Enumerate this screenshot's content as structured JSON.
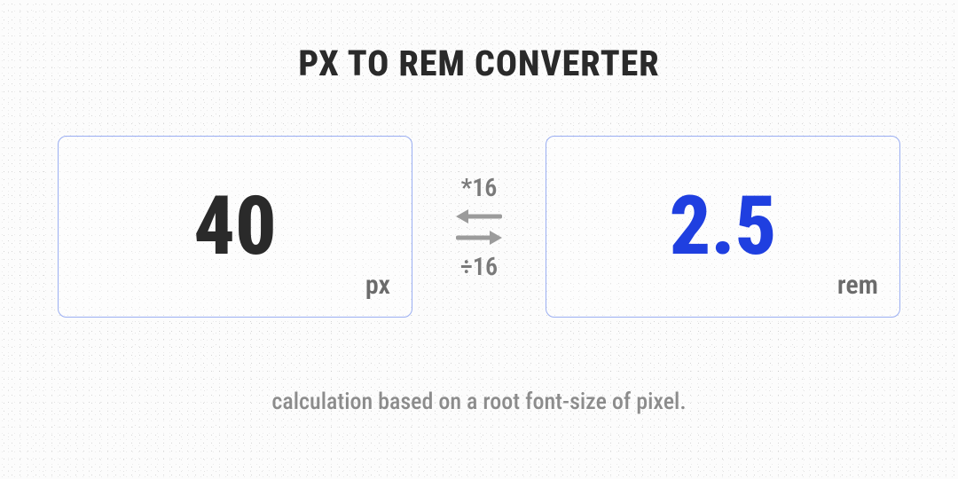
{
  "title": "PX TO REM CONVERTER",
  "left": {
    "value": "40",
    "unit": "px"
  },
  "right": {
    "value": "2.5",
    "unit": "rem"
  },
  "middle": {
    "top_op": "*16",
    "bottom_op": "÷16"
  },
  "footnote": "calculation based on a root font-size of  pixel.",
  "colors": {
    "accent": "#1f3fe0",
    "border": "#9aaef2"
  }
}
